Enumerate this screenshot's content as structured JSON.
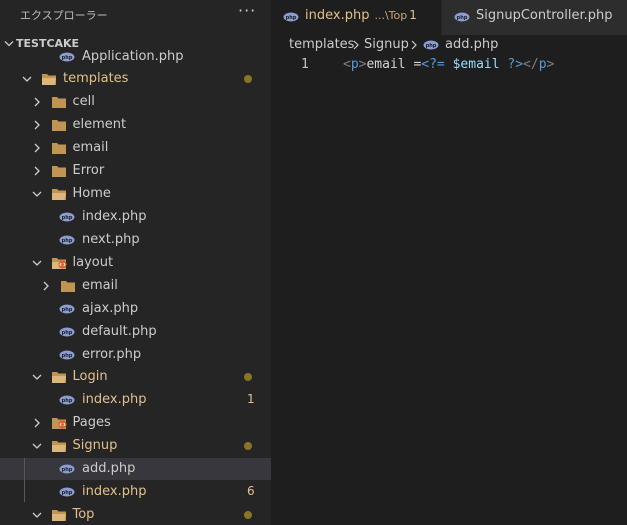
{
  "sidebar": {
    "title": "エクスプローラー",
    "more_label": "···",
    "project": "TESTCAKE",
    "items": [
      {
        "label": "Application.php",
        "kind": "file"
      },
      {
        "label": "templates",
        "kind": "folder",
        "open": true,
        "modified": true
      },
      {
        "label": "cell",
        "kind": "folder",
        "open": false
      },
      {
        "label": "element",
        "kind": "folder",
        "open": false
      },
      {
        "label": "email",
        "kind": "folder",
        "open": false
      },
      {
        "label": "Error",
        "kind": "folder",
        "open": false
      },
      {
        "label": "Home",
        "kind": "folder",
        "open": true
      },
      {
        "label": "index.php",
        "kind": "file"
      },
      {
        "label": "next.php",
        "kind": "file"
      },
      {
        "label": "layout",
        "kind": "folder-special",
        "open": true
      },
      {
        "label": "email",
        "kind": "folder",
        "open": false
      },
      {
        "label": "ajax.php",
        "kind": "file"
      },
      {
        "label": "default.php",
        "kind": "file"
      },
      {
        "label": "error.php",
        "kind": "file"
      },
      {
        "label": "Login",
        "kind": "folder",
        "open": true,
        "modified": true
      },
      {
        "label": "index.php",
        "kind": "file",
        "modified": true,
        "count": "1"
      },
      {
        "label": "Pages",
        "kind": "folder-special",
        "open": false
      },
      {
        "label": "Signup",
        "kind": "folder",
        "open": true,
        "modified": true
      },
      {
        "label": "add.php",
        "kind": "file",
        "selected": true
      },
      {
        "label": "index.php",
        "kind": "file",
        "modified": true,
        "count": "6"
      },
      {
        "label": "Top",
        "kind": "folder",
        "open": true,
        "modified": true
      }
    ]
  },
  "tabs": [
    {
      "label": "index.php",
      "path": "...\\Top",
      "badge": "1",
      "active": true
    },
    {
      "label": "SignupController.php",
      "active": false
    }
  ],
  "breadcrumb": [
    "templates",
    "Signup",
    "add.php"
  ],
  "editor": {
    "line_number": "1",
    "tokens": [
      {
        "text": "<",
        "style": "t-punct"
      },
      {
        "text": "p",
        "style": "t-tag"
      },
      {
        "text": ">",
        "style": "t-punct"
      },
      {
        "text": "email =",
        "style": "t-text"
      },
      {
        "text": "<?=",
        "style": "t-php"
      },
      {
        "text": " ",
        "style": "t-text"
      },
      {
        "text": "$email",
        "style": "t-var"
      },
      {
        "text": " ",
        "style": "t-text"
      },
      {
        "text": "?>",
        "style": "t-php"
      },
      {
        "text": "</",
        "style": "t-punct"
      },
      {
        "text": "p",
        "style": "t-tag"
      },
      {
        "text": ">",
        "style": "t-punct"
      }
    ]
  },
  "colors": {
    "modified": "#e2c08d",
    "modified_dot": "#8a7424",
    "folder": "#c09553",
    "layout_badge": "#e05a2c",
    "php_icon": "#8b9bd3"
  }
}
